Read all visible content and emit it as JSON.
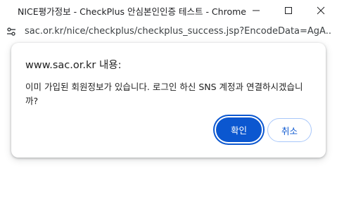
{
  "window": {
    "title": "NICE평가정보 - CheckPlus 안심본인인증 테스트 - Chrome"
  },
  "address_bar": {
    "url": "sac.or.kr/nice/checkplus/checkplus_success.jsp?EncodeData=AgA..."
  },
  "dialog": {
    "title": "www.sac.or.kr 내용:",
    "message": "이미 가입된 회원정보가 있습니다. 로그인 하신 SNS 계정과 연결하시겠습니까?",
    "ok_label": "확인",
    "cancel_label": "취소"
  },
  "colors": {
    "accent": "#0b57d0",
    "cancel_border": "#a8c7fa"
  },
  "icons": [
    "minimize-icon",
    "maximize-icon",
    "close-icon",
    "site-info-icon"
  ]
}
